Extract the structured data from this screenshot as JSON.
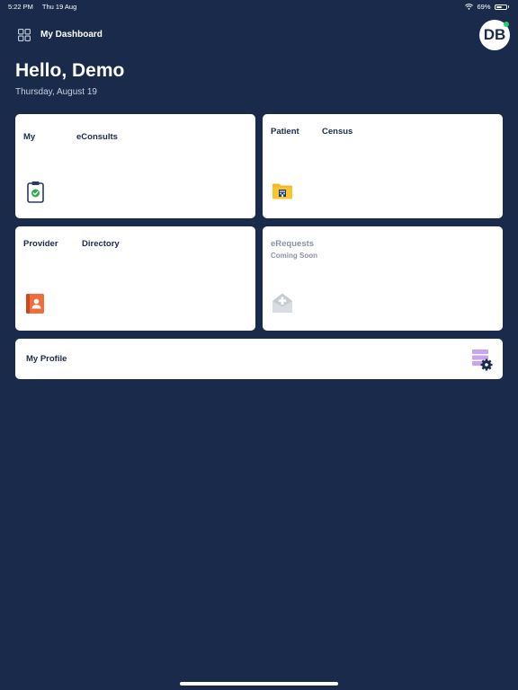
{
  "status": {
    "time": "5:22 PM",
    "date": "Thu 19 Aug",
    "battery": "69%",
    "battery_level": 0.69
  },
  "header": {
    "title": "My Dashboard",
    "avatar_initials": "DB"
  },
  "greeting": {
    "hello": "Hello, Demo",
    "date": "Thursday, August 19"
  },
  "cards": {
    "econsults": {
      "word1": "My",
      "word2": "eConsults",
      "icon": "clipboard-check-icon"
    },
    "census": {
      "word1": "Patient",
      "word2": "Census",
      "icon": "hospital-folder-icon"
    },
    "directory": {
      "word1": "Provider",
      "word2": "Directory",
      "icon": "contact-book-icon"
    },
    "erequests": {
      "title": "eRequests",
      "subtitle": "Coming Soon",
      "icon": "medical-envelope-icon"
    },
    "profile": {
      "title": "My Profile",
      "icon": "settings-stack-icon"
    }
  },
  "colors": {
    "background": "#1a2a4b",
    "card": "#ffffff",
    "online": "#2ecc71"
  }
}
